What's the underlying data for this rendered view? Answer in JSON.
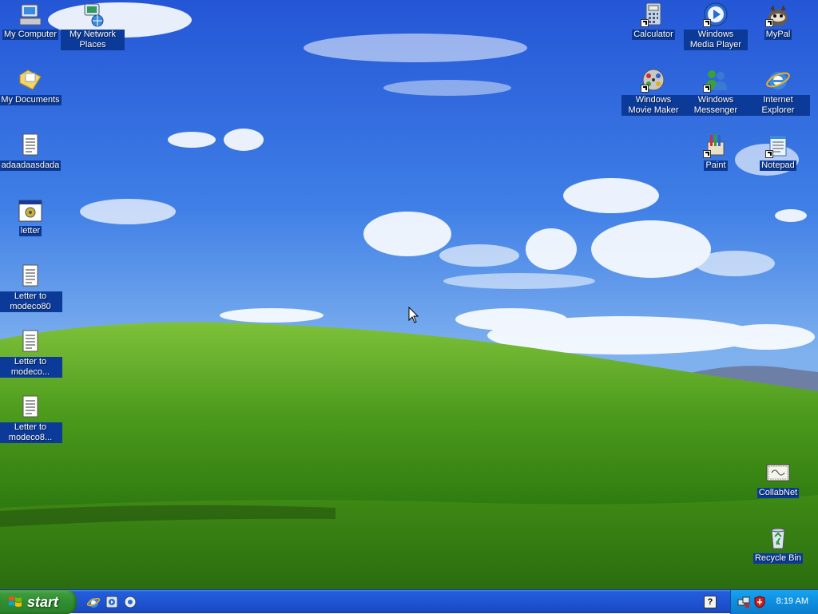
{
  "desktop": {
    "icons": [
      {
        "label": "My Computer"
      },
      {
        "label": "My Network Places"
      },
      {
        "label": "My Documents"
      },
      {
        "label": "adaadaasdada"
      },
      {
        "label": "letter"
      },
      {
        "label": "Letter to modeco80"
      },
      {
        "label": "Letter to modeco..."
      },
      {
        "label": "Letter to modeco8..."
      },
      {
        "label": "Calculator"
      },
      {
        "label": "Windows Media Player"
      },
      {
        "label": "MyPal"
      },
      {
        "label": "Windows Movie Maker"
      },
      {
        "label": "Windows Messenger"
      },
      {
        "label": "Internet Explorer"
      },
      {
        "label": "Paint"
      },
      {
        "label": "Notepad"
      },
      {
        "label": "CollabNet"
      },
      {
        "label": "Recycle Bin"
      }
    ]
  },
  "taskbar": {
    "start_label": "start",
    "quick_launch": [
      "internet-explorer-icon",
      "media-player-icon",
      "show-desktop-icon"
    ],
    "help_glyph": "?",
    "clock": "8:19 AM"
  },
  "colors": {
    "taskbar_blue": "#245edb",
    "start_green": "#3c9a3c",
    "tray_blue": "#0f8ee0",
    "label_selection": "#0b3a98"
  }
}
